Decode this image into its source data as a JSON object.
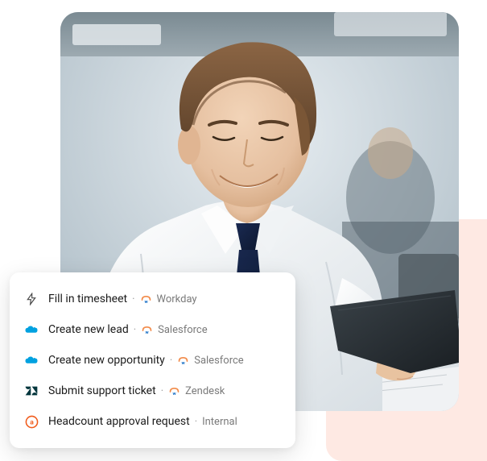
{
  "menu": {
    "items": [
      {
        "icon": "lightning",
        "label": "Fill in timesheet",
        "source_icon": "workday",
        "source": "Workday"
      },
      {
        "icon": "salesforce-cloud",
        "label": "Create new lead",
        "source_icon": "workday",
        "source": "Salesforce"
      },
      {
        "icon": "salesforce-cloud",
        "label": "Create new opportunity",
        "source_icon": "workday",
        "source": "Salesforce"
      },
      {
        "icon": "zendesk",
        "label": "Submit support ticket",
        "source_icon": "workday",
        "source": "Zendesk"
      },
      {
        "icon": "circle-a",
        "label": "Headcount approval request",
        "source_icon": "",
        "source": "Internal"
      }
    ]
  },
  "colors": {
    "accent_orange": "#f28b4a",
    "salesforce_blue": "#00a1e0",
    "zendesk_green": "#03363d",
    "circle_orange": "#f05a1a"
  }
}
